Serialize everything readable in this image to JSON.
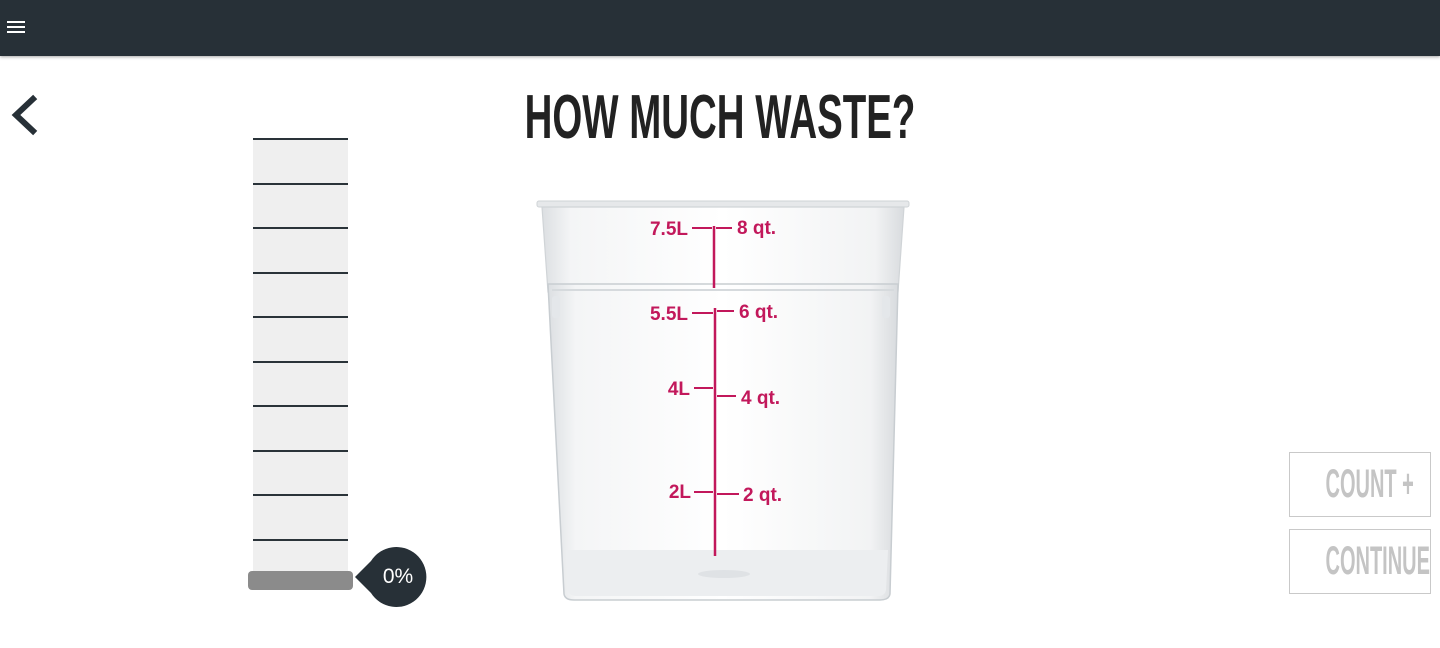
{
  "header": {
    "menu_icon": "hamburger-menu-icon",
    "background_color": "#273037"
  },
  "nav": {
    "back_icon": "chevron-left-icon"
  },
  "page": {
    "title": "HOW MUCH WASTE?"
  },
  "fill_slider": {
    "value_label": "0%",
    "fill_fraction": 0,
    "tick_count": 10
  },
  "container_image": {
    "left_scale": [
      "7.5L",
      "5.5L",
      "4L",
      "2L"
    ],
    "right_scale": [
      "8 qt.",
      "6 qt.",
      "4 qt.",
      "2 qt."
    ],
    "marking_color": "#c2185b"
  },
  "actions": {
    "count_label": "COUNT +",
    "continue_label": "CONTINUE>"
  }
}
